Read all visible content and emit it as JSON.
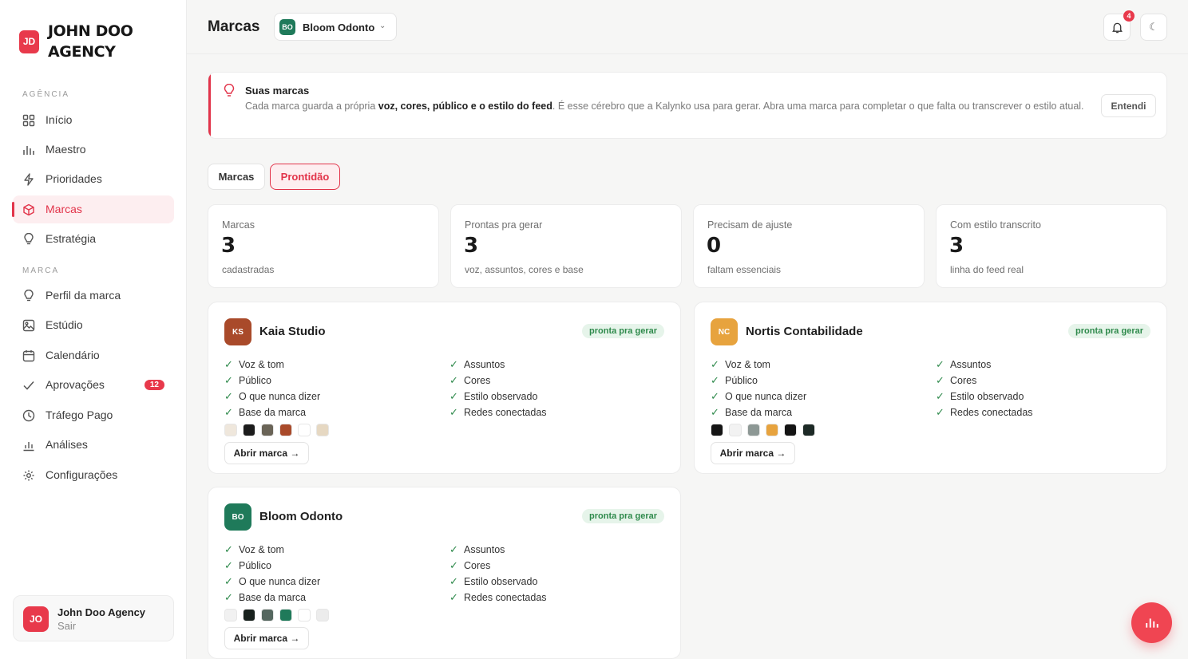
{
  "sidebar": {
    "brand_initials": "JD",
    "brand_name": "JOHN DOO AGENCY",
    "section_agencia": "AGÊNCIA",
    "section_marca": "MARCA",
    "items": [
      {
        "label": "Início",
        "icon": "grid-icon"
      },
      {
        "label": "Maestro",
        "icon": "bars-icon"
      },
      {
        "label": "Prioridades",
        "icon": "bolt-icon"
      },
      {
        "label": "Marcas",
        "icon": "cube-icon",
        "active": true
      },
      {
        "label": "Estratégia",
        "icon": "bulb-icon"
      },
      {
        "label": "Perfil da marca",
        "icon": "bulb-icon"
      },
      {
        "label": "Estúdio",
        "icon": "image-icon"
      },
      {
        "label": "Calendário",
        "icon": "calendar-icon"
      },
      {
        "label": "Aprovações",
        "icon": "check-icon",
        "badge": "12"
      },
      {
        "label": "Tráfego Pago",
        "icon": "clock-icon"
      },
      {
        "label": "Análises",
        "icon": "chart-icon"
      },
      {
        "label": "Configurações",
        "icon": "gear-icon"
      }
    ],
    "user": {
      "initials": "JO",
      "name": "John Doo Agency",
      "action": "Sair"
    }
  },
  "header": {
    "title": "Marcas",
    "brand_select": {
      "initials": "BO",
      "label": "Bloom Odonto"
    },
    "notification_count": "4"
  },
  "banner": {
    "title": "Suas marcas",
    "text_before": "Cada marca guarda a própria ",
    "text_bold": "voz, cores, público e o estilo do feed",
    "text_after": ". É esse cérebro que a Kalynko usa para gerar. Abra uma marca para completar o que falta ou transcrever o estilo atual.",
    "button": "Entendi"
  },
  "tabs": [
    "Marcas",
    "Prontidão"
  ],
  "stats": [
    {
      "label": "Marcas",
      "value": "3",
      "sub": "cadastradas"
    },
    {
      "label": "Prontas pra gerar",
      "value": "3",
      "sub": "voz, assuntos, cores e base"
    },
    {
      "label": "Precisam de ajuste",
      "value": "0",
      "sub": "faltam essenciais"
    },
    {
      "label": "Com estilo transcrito",
      "value": "3",
      "sub": "linha do feed real"
    }
  ],
  "brand_cards": [
    {
      "initials": "KS",
      "name": "Kaia Studio",
      "status": "pronta pra gerar",
      "badge_color": "#a94a2a",
      "left_checks": [
        "Voz & tom",
        "Público",
        "O que nunca dizer",
        "Base da marca"
      ],
      "right_checks": [
        "Assuntos",
        "Cores",
        "Estilo observado",
        "Redes conectadas"
      ],
      "swatches": [
        "#efe7dc",
        "#1c1c1c",
        "#6a6457",
        "#a94a2a",
        "#ffffff",
        "#e6d8c2"
      ],
      "button": "Abrir marca →"
    },
    {
      "initials": "NC",
      "name": "Nortis Contabilidade",
      "status": "pronta pra gerar",
      "badge_color": "#e7a33e",
      "left_checks": [
        "Voz & tom",
        "Público",
        "O que nunca dizer",
        "Base da marca"
      ],
      "right_checks": [
        "Assuntos",
        "Cores",
        "Estilo observado",
        "Redes conectadas"
      ],
      "swatches": [
        "#151515",
        "#f2f2f2",
        "#8d9895",
        "#e7a33e",
        "#141414",
        "#1d2a26"
      ],
      "button": "Abrir marca →"
    },
    {
      "initials": "BO",
      "name": "Bloom Odonto",
      "status": "pronta pra gerar",
      "badge_color": "#1f7a5a",
      "left_checks": [
        "Voz & tom",
        "Público",
        "O que nunca dizer",
        "Base da marca"
      ],
      "right_checks": [
        "Assuntos",
        "Cores",
        "Estilo observado",
        "Redes conectadas"
      ],
      "swatches": [
        "#f1f1f1",
        "#18211d",
        "#55675f",
        "#1f7a5a",
        "#ffffff",
        "#ececec"
      ],
      "button": "Abrir marca →"
    }
  ],
  "colors": {
    "accent": "#e2344a",
    "ready_green": "#2f8a4c"
  }
}
